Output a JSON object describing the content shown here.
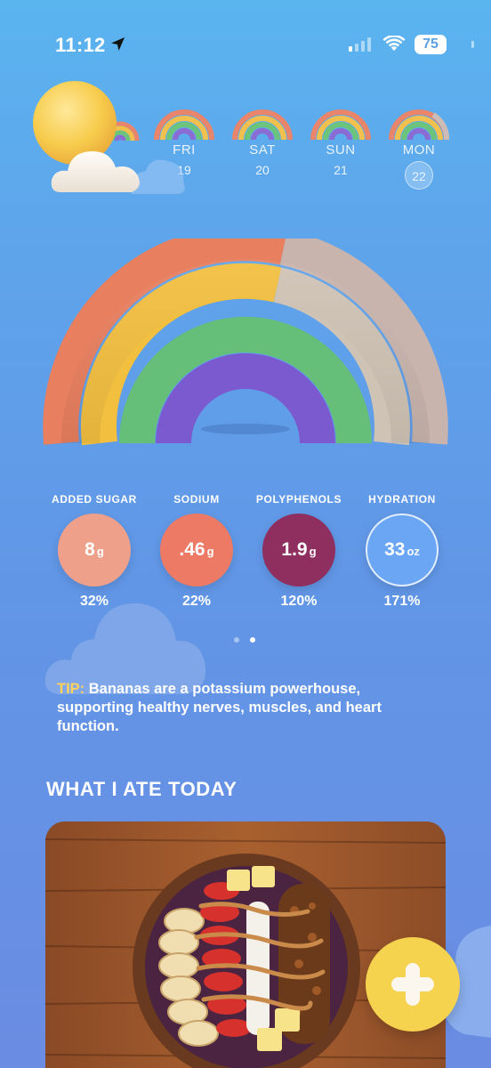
{
  "status_bar": {
    "time": "11:12",
    "battery": "75"
  },
  "days": [
    {
      "name": "FRI",
      "num": "19",
      "selected": false
    },
    {
      "name": "SAT",
      "num": "20",
      "selected": false
    },
    {
      "name": "SUN",
      "num": "21",
      "selected": false
    },
    {
      "name": "MON",
      "num": "22",
      "selected": true
    }
  ],
  "nutrients": [
    {
      "label": "ADDED SUGAR",
      "value": "8",
      "unit": "g",
      "percent": "32%",
      "color": "#eea08a"
    },
    {
      "label": "SODIUM",
      "value": ".46",
      "unit": "g",
      "percent": "22%",
      "color": "#ec7a64"
    },
    {
      "label": "POLYPHENOLS",
      "value": "1.9",
      "unit": "g",
      "percent": "120%",
      "color": "#8f2f5f"
    },
    {
      "label": "HYDRATION",
      "value": "33",
      "unit": "oz",
      "percent": "171%",
      "color": "#6aa6f4"
    }
  ],
  "pager": {
    "count": 2,
    "active": 1
  },
  "tip": {
    "label": "TIP:",
    "text": "Bananas are a potassium powerhouse, supporting healthy nerves, muscles, and heart function."
  },
  "section_title": "WHAT I ATE TODAY",
  "icons": {
    "location": "location-arrow-icon",
    "signal": "cellular-signal-icon",
    "wifi": "wifi-icon",
    "battery": "battery-icon",
    "weather": "sun-behind-cloud-icon",
    "add": "plus-icon"
  }
}
